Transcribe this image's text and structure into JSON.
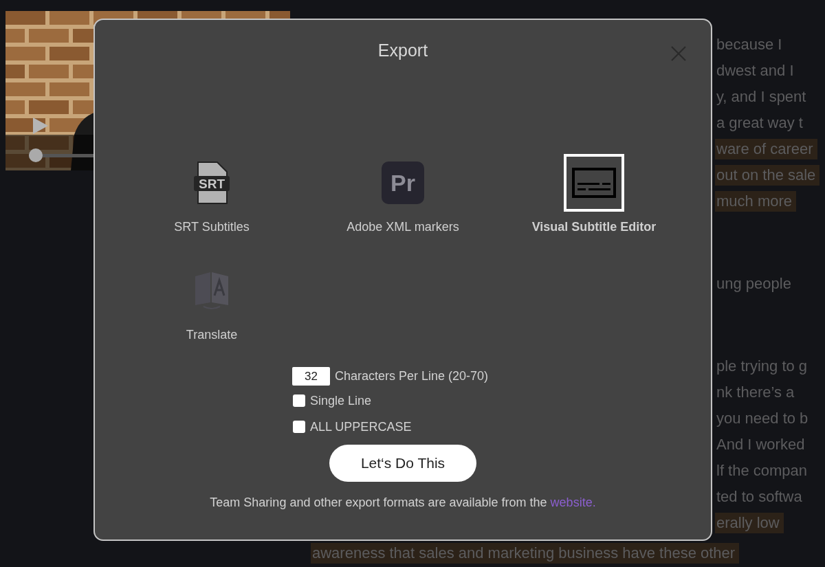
{
  "video": {
    "progress": {
      "level": 0
    }
  },
  "transcript": [
    {
      "lines": [
        {
          "text": "because I",
          "highlighted": false
        },
        {
          "text": "dwest and I",
          "highlighted": false
        },
        {
          "text": "y, and I spent",
          "highlighted": false
        },
        {
          "text": "a great way t",
          "highlighted": false
        },
        {
          "text": "ware of career",
          "highlighted": true
        },
        {
          "text": "out on the sale",
          "highlighted": true
        },
        {
          "text": "much more",
          "highlighted": true
        }
      ]
    },
    {
      "lines": [
        {
          "text": "ung people",
          "highlighted": false
        }
      ]
    },
    {
      "lines": [
        {
          "text": "ple trying to g",
          "highlighted": false
        },
        {
          "text": "nk there’s a",
          "highlighted": false
        },
        {
          "text": "you need to b",
          "highlighted": false
        },
        {
          "text": "And I worked",
          "highlighted": false
        },
        {
          "text": "lf the compan",
          "highlighted": false
        },
        {
          "text": "ted to softwa",
          "highlighted": false
        },
        {
          "text": "erally low",
          "highlighted": true
        },
        {
          "text": "awareness that sales and marketing business have these other",
          "highlighted": true,
          "full": true
        }
      ]
    }
  ],
  "dialog": {
    "title": "Export",
    "options": [
      {
        "kind": "srt",
        "icon_text": "SRT",
        "label": "SRT Subtitles",
        "selected": false
      },
      {
        "kind": "premiere",
        "icon_text": "Pr",
        "label": "Adobe XML markers",
        "selected": false
      },
      {
        "kind": "subtitle-editor",
        "label": "Visual Subtitle Editor",
        "selected": true
      },
      {
        "kind": "translate",
        "label": "Translate",
        "selected": false
      }
    ],
    "chars_per_line": {
      "value": "32",
      "label": "Characters Per Line (20-70)"
    },
    "checkboxes": [
      {
        "label": "Single Line",
        "checked": false
      },
      {
        "label": "ALL UPPERCASE",
        "checked": false
      }
    ],
    "button": "Let‘s Do This",
    "footer": {
      "text": "Team Sharing and other export formats are available from the",
      "link": "website."
    }
  }
}
